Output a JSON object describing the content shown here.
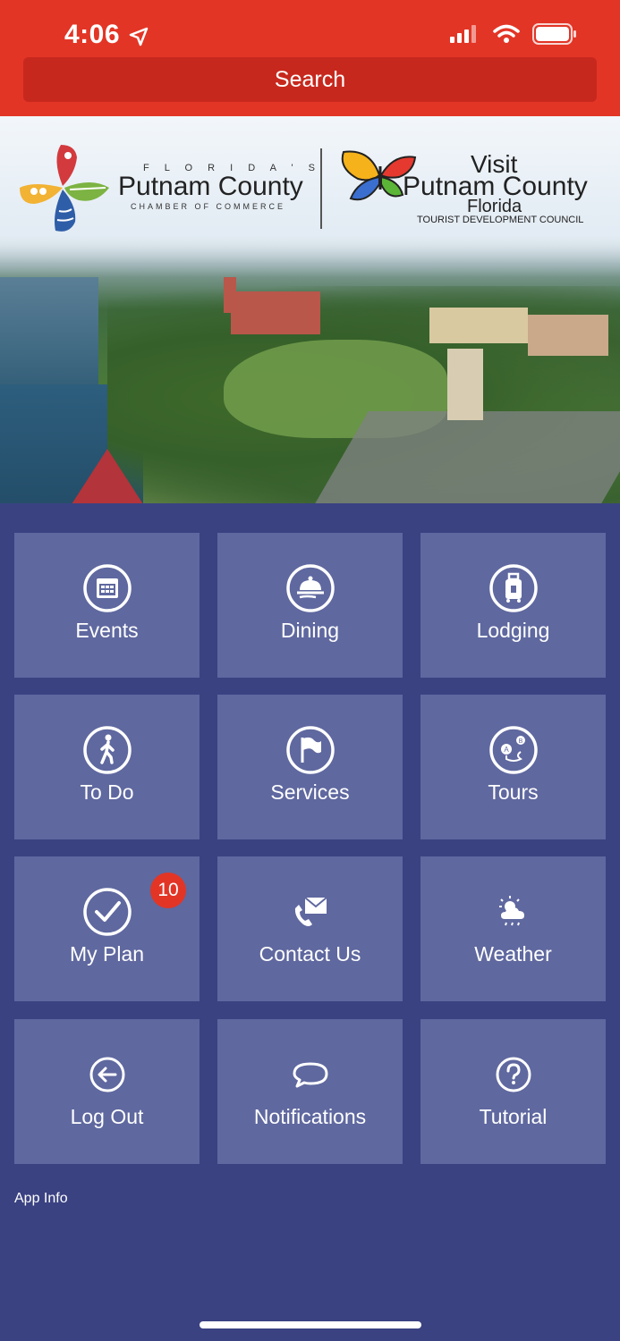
{
  "status": {
    "time": "4:06"
  },
  "search": {
    "label": "Search"
  },
  "hero": {
    "chamber_line1": "F L O R I D A ' S",
    "chamber_line2": "Putnam County",
    "chamber_line3": "CHAMBER OF COMMERCE",
    "visit_line1": "Visit",
    "visit_line2": "Putnam County",
    "visit_line3": "Florida",
    "visit_line4": "TOURIST DEVELOPMENT COUNCIL"
  },
  "tiles": [
    {
      "label": "Events",
      "icon": "calendar-icon"
    },
    {
      "label": "Dining",
      "icon": "cloche-icon"
    },
    {
      "label": "Lodging",
      "icon": "luggage-icon"
    },
    {
      "label": "To Do",
      "icon": "walking-person-icon"
    },
    {
      "label": "Services",
      "icon": "flag-icon"
    },
    {
      "label": "Tours",
      "icon": "route-map-icon"
    },
    {
      "label": "My Plan",
      "icon": "checkmark-icon"
    },
    {
      "label": "Contact Us",
      "icon": "phone-envelope-icon"
    },
    {
      "label": "Weather",
      "icon": "sun-cloud-icon"
    },
    {
      "label": "Log Out",
      "icon": "back-arrow-icon"
    },
    {
      "label": "Notifications",
      "icon": "chat-bubble-icon"
    },
    {
      "label": "Tutorial",
      "icon": "question-icon"
    }
  ],
  "my_plan_badge": "10",
  "footer": {
    "app_info": "App Info"
  },
  "colors": {
    "accent": "#e23526",
    "background": "#3a4282",
    "tile": "#5f689f"
  }
}
